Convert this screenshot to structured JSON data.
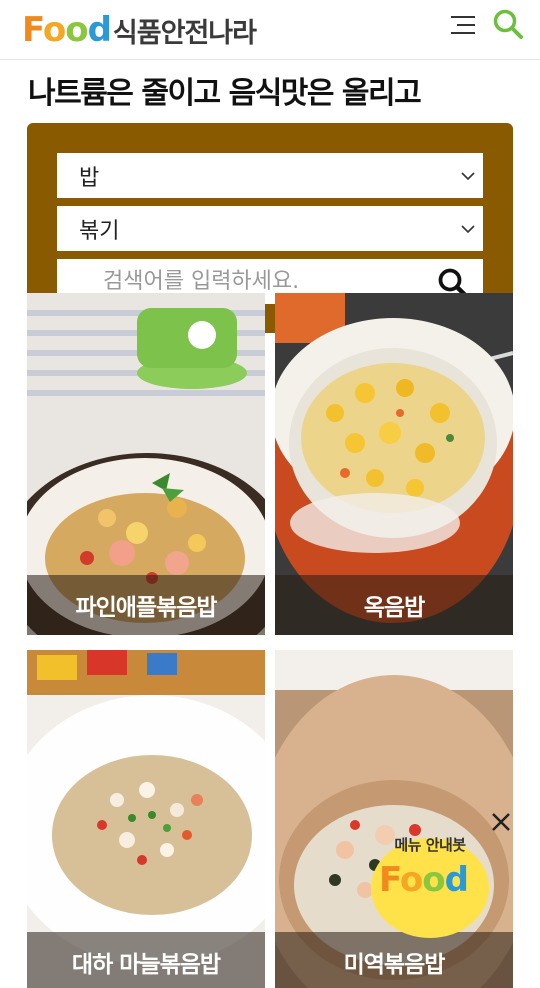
{
  "header": {
    "logo_text": "식품안전나라",
    "logo_food": {
      "f": "F",
      "o1": "o",
      "o2": "o",
      "d": "d"
    }
  },
  "page": {
    "title": "나트륨은 줄이고 음식맛은 올리고"
  },
  "search": {
    "category_value": "밥",
    "method_value": "볶기",
    "placeholder": "검색어를 입력하세요."
  },
  "recipes": [
    {
      "name": "파인애플볶음밥"
    },
    {
      "name": "옥음밥"
    },
    {
      "name": "대하 마늘볶음밥"
    },
    {
      "name": "미역볶음밥"
    }
  ],
  "chatbot": {
    "label": "메뉴 안내봇",
    "food": {
      "f": "F",
      "o1": "o",
      "o2": "o",
      "d": "d"
    }
  },
  "colors": {
    "search_panel": "#8a5a00",
    "caption_overlay": "rgba(40,30,20,0.55)",
    "bot_bg": "#ffe24a"
  }
}
